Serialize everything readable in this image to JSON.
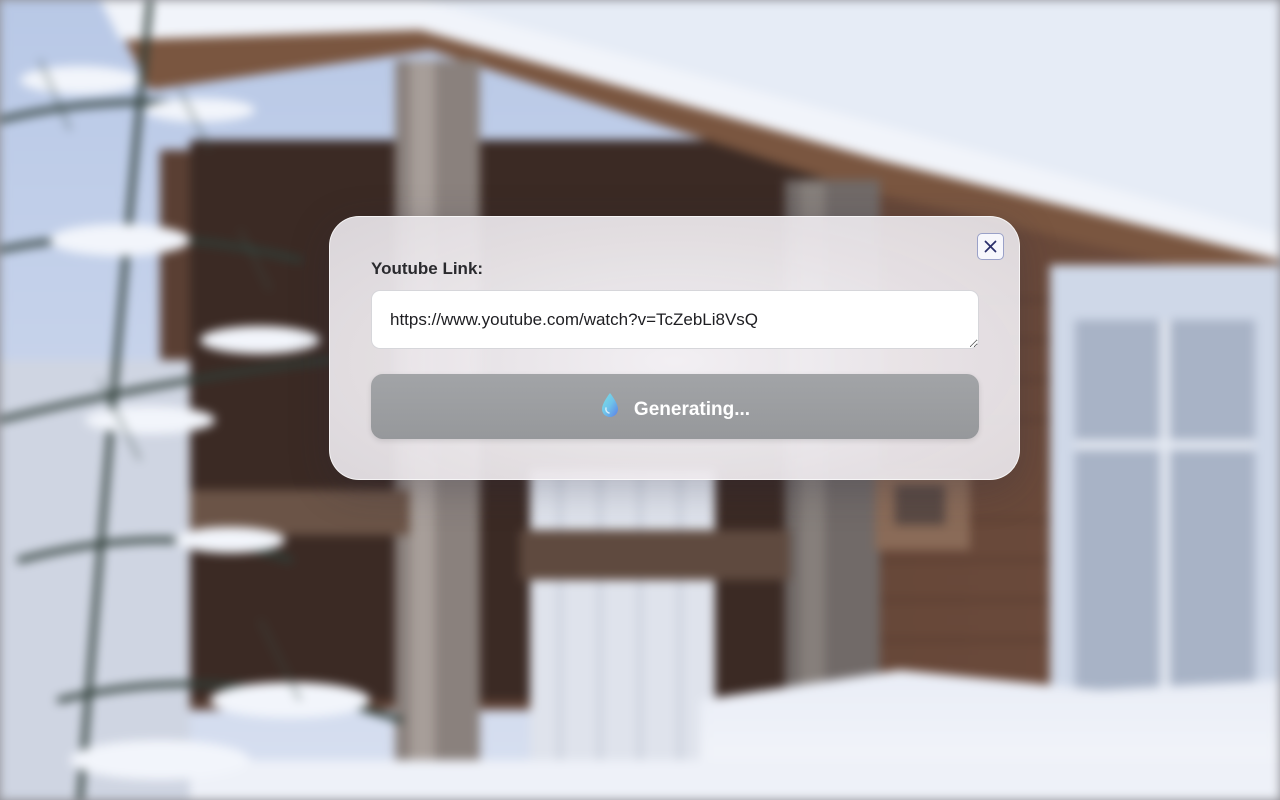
{
  "modal": {
    "label": "Youtube Link:",
    "url_value": "https://www.youtube.com/watch?v=TcZebLi8VsQ",
    "generate_label": "Generating...",
    "close_icon": "close-icon",
    "spinner_icon": "water-drop-icon"
  },
  "colors": {
    "button_bg": "#9b9da0",
    "close_border": "#9aa1c8",
    "close_glyph": "#2b2f6b",
    "drop_top": "#6fd3e8",
    "drop_bottom": "#5a8ae6"
  }
}
